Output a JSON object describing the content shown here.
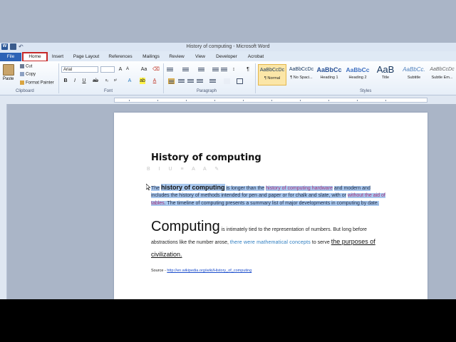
{
  "window": {
    "title": "History of computing - Microsoft Word"
  },
  "tabs": [
    "File",
    "Home",
    "Insert",
    "Page Layout",
    "References",
    "Mailings",
    "Review",
    "View",
    "Developer",
    "Acrobat"
  ],
  "clipboard": {
    "paste_label": "Paste",
    "cut_label": "Cut",
    "copy_label": "Copy",
    "format_painter_label": "Format Painter",
    "group_label": "Clipboard"
  },
  "font": {
    "family": "Arial",
    "group_label": "Font"
  },
  "paragraph": {
    "group_label": "Paragraph"
  },
  "styles": {
    "group_label": "Styles",
    "items": [
      {
        "sample": "AaBbCcDc",
        "label": "¶ Normal"
      },
      {
        "sample": "AaBbCcDc",
        "label": "¶ No Spaci..."
      },
      {
        "sample": "AaBbCc",
        "label": "Heading 1"
      },
      {
        "sample": "AaBbCc",
        "label": "Heading 2"
      },
      {
        "sample": "AaB",
        "label": "Title"
      },
      {
        "sample": "AaBbCc.",
        "label": "Subtitle"
      },
      {
        "sample": "AaBbCcDc",
        "label": "Subtle Em..."
      }
    ]
  },
  "document": {
    "title": "History of computing",
    "para1": {
      "the": "The",
      "bold": "history of computing",
      "t1": "is longer than the",
      "link1": "history of computing hardware",
      "t2": "and modern and includes the history of methods intended for pen and paper or for chalk and slate, with or",
      "link2": "without the aid of tables",
      "t3": ". The timeline of computing presents a summary list of major developments in computing by date."
    },
    "para2": {
      "big": "Computing",
      "t1": "is intimately tied to the representation of numbers. But long before abstractions like the number arose,",
      "blue": "there were mathematical concepts",
      "t2": "to serve",
      "underline": "the purposes of civilization."
    },
    "source": {
      "label": "Source - ",
      "url": "http://en.wikipedia.org/wiki/History_of_computing"
    }
  }
}
